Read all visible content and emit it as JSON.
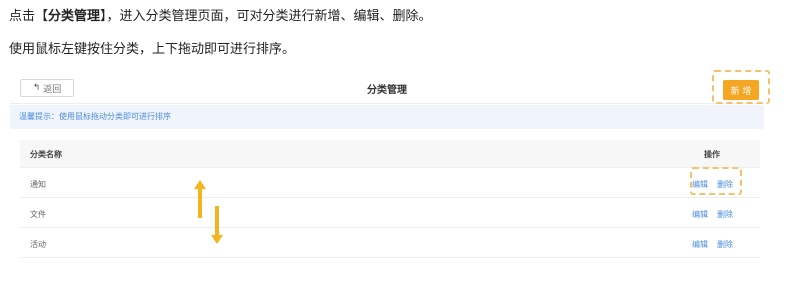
{
  "instructions": {
    "line1_bracket_open": "点击【",
    "line1_bracket_label": "分类管理",
    "line1_bracket_close": "】",
    "line1_rest": "，进入分类管理页面，可对分类进行新增、编辑、删除。",
    "line2": "使用鼠标左键按住分类，上下拖动即可进行排序。"
  },
  "header": {
    "back_icon": "back-arrow-icon",
    "back_label": "返回",
    "title": "分类管理",
    "new_label": "新 增"
  },
  "tip": {
    "text": "温馨提示：使用鼠标拖动分类即可进行排序"
  },
  "table": {
    "columns": {
      "name": "分类名称",
      "ops": "操作"
    },
    "rows": [
      {
        "name": "通知",
        "edit": "编辑",
        "delete": "删除"
      },
      {
        "name": "文件",
        "edit": "编辑",
        "delete": "删除"
      },
      {
        "name": "活动",
        "edit": "编辑",
        "delete": "删除"
      }
    ]
  },
  "colors": {
    "accent": "#f5a623",
    "link": "#4a8be0",
    "tip_background": "#f0f4fb",
    "annotation_arrow": "#f5b320"
  }
}
